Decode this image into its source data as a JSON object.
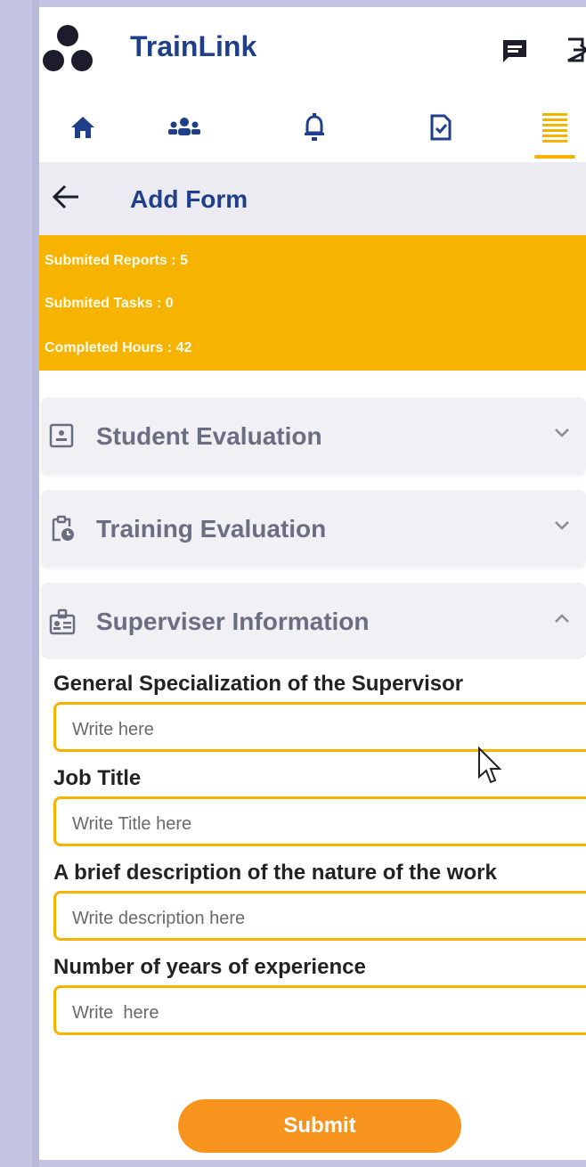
{
  "app": {
    "title": "TrainLink"
  },
  "nav": {
    "items": [
      {
        "name": "home-icon"
      },
      {
        "name": "users-icon"
      },
      {
        "name": "bell-icon"
      },
      {
        "name": "document-check-icon"
      },
      {
        "name": "menu-list-icon"
      }
    ],
    "active_index": 4
  },
  "subheader": {
    "title": "Add Form"
  },
  "stats": {
    "reports": "Submited Reports : 5",
    "tasks": "Submited Tasks : 0",
    "hours": "Completed Hours : 42"
  },
  "sections": [
    {
      "title": "Student Evaluation",
      "icon": "id-card-icon",
      "expanded": false
    },
    {
      "title": "Training Evaluation",
      "icon": "clipboard-clock-icon",
      "expanded": false
    },
    {
      "title": "Superviser Information",
      "icon": "badge-card-icon",
      "expanded": true
    }
  ],
  "form": {
    "fields": [
      {
        "label": "General Specialization of the Supervisor",
        "placeholder": "Write here",
        "value": ""
      },
      {
        "label": "Job Title",
        "placeholder": "Write Title here",
        "value": ""
      },
      {
        "label": "A brief description of the nature of the work",
        "placeholder": "Write description here",
        "value": ""
      },
      {
        "label": "Number of years of experience",
        "placeholder": "Write  here",
        "value": ""
      }
    ],
    "submit_label": "Submit"
  },
  "colors": {
    "brand_blue": "#1f3f8a",
    "accent_yellow": "#f6b400",
    "submit_orange": "#f7941d"
  }
}
